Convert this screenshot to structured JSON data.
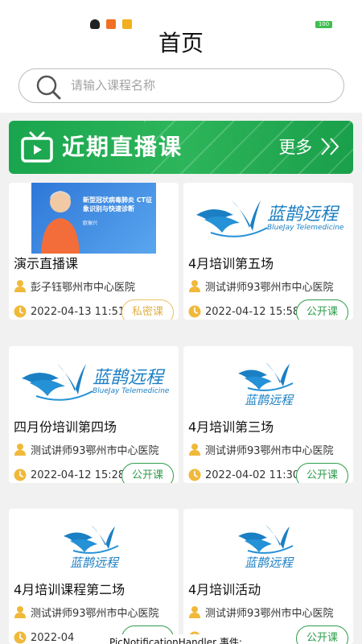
{
  "status_bar": {
    "battery": "100",
    "notification_icons": [
      "qq-icon",
      "mi-icon",
      "message-icon"
    ]
  },
  "header": {
    "title": "首页",
    "search_placeholder": "请输入课程名称"
  },
  "banner": {
    "title": "近期直播课",
    "more_label": "更多",
    "colors": {
      "primary": "#1fa855"
    }
  },
  "courses": [
    {
      "title": "演示直播课",
      "host": "彭子钰鄂州市中心医院",
      "time": "2022-04-13 11:51",
      "tag": "私密课",
      "thumb": "presenter-photo",
      "promo_text": "新型冠状病毒肺炎 CT征象识别与快速诊断",
      "promo_name": "欧振兴"
    },
    {
      "title": "4月培训第五场",
      "host": "测试讲师93鄂州市中心医院",
      "time": "2022-04-12 15:58",
      "tag": "公开课",
      "thumb": "bluejay-logo-wide",
      "logo_cn": "蓝鹊远程",
      "logo_en": "BlueJay Telemedicine"
    },
    {
      "title": "四月份培训第四场",
      "host": "测试讲师93鄂州市中心医院",
      "time": "2022-04-12 15:28",
      "tag": "公开课",
      "thumb": "bluejay-logo-wide",
      "logo_cn": "蓝鹊远程",
      "logo_en": "BlueJay Telemedicine"
    },
    {
      "title": "4月培训第三场",
      "host": "测试讲师93鄂州市中心医院",
      "time": "2022-04-02 11:30",
      "tag": "公开课",
      "thumb": "bluejay-logo-small",
      "logo_cn": "蓝鹊远程"
    },
    {
      "title": "4月培训课程第二场",
      "host": "测试讲师93鄂州市中心医院",
      "time": "2022-04",
      "tag": "",
      "thumb": "bluejay-logo-small",
      "logo_cn": "蓝鹊远程"
    },
    {
      "title": "4月培训活动",
      "host": "测试讲师93鄂州市中心医院",
      "time": "",
      "tag": "公开课",
      "thumb": "bluejay-logo-small",
      "logo_cn": "蓝鹊远程"
    }
  ],
  "toast": {
    "text": "PicNotificationHandler 事件:"
  },
  "colors": {
    "accent_green": "#2e9d4c",
    "private_gold": "#e1b044",
    "icon_gold": "#f0b93a",
    "logo_blue": "#1b7fc4"
  }
}
